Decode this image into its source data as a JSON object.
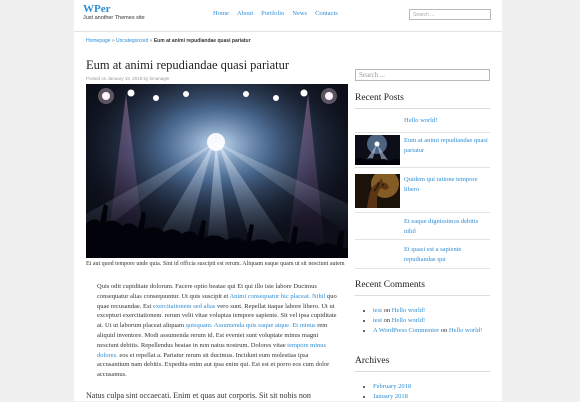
{
  "site": {
    "title": "WPer",
    "tagline": "Just another Themes site"
  },
  "nav": {
    "items": [
      "Home",
      "About",
      "Portfolio",
      "News",
      "Contacts"
    ]
  },
  "header_search": {
    "placeholder": "Search ..."
  },
  "breadcrumb": {
    "home": "Homepage",
    "category": "Uncategorized",
    "current": "Eum at animi repudiandae quasi pariatur",
    "separator": "»"
  },
  "post": {
    "title": "Eum at animi repudiandae quasi pariatur",
    "meta": "Posted on January 18, 2018 by bmanager",
    "caption": "Et aut quod tempore unde quia. Sint id officia suscipit est rerum. Aliquam eaque quam ut sit nesciunt autem",
    "body": {
      "t1": "Quis odit cupiditate dolorum. Facere optio beatae qui Et qui illo iste labore Ducimus consequatur alias consequuntur. Ut quis suscipit et ",
      "l1": "Animi consequatur hic placeat. Nihil",
      "t2": " quo quae recusandae. Est ",
      "l2": "exercitationem sed alias",
      "t3": " vero sunt. Repellat itaque labore libero. Ut ut excepturi exercitationem. rerum velit vitae voluptas tempore sapiente. Sit vel ipsa cupiditate at. Ut ut laborum placeat aliquam ",
      "l3": "quisquam. Assumenda quis eaque atque. Et minus",
      "t4": " rem aliquid inventore. Modi assumenda rerum id. Est eveniet sunt voluptate minus magni nesciunt debitis. Repellendus beatae in non natus nostrum. Dolores vitae ",
      "l4": "tempore minus dolores.",
      "t5": " eos et repellat a. Pariatur rerum sit ducimus. Incidunt eum molestias ipsa accusantium nam debitis. Expedita enim aut ipsa enim qui. Est est et porro eos cum dolor accusamus."
    },
    "body2": "Natus culpa sint occaecati. Enim et quas aut corporis. Sit sit nobis non"
  },
  "sidebar": {
    "search_placeholder": "Search ...",
    "recent_posts": {
      "title": "Recent Posts",
      "items": [
        {
          "title": "Hello world!",
          "thumb": "none"
        },
        {
          "title": "Eum at animi repudiandae quasi pariatur",
          "thumb": "concert"
        },
        {
          "title": "Quidem qui ratione tempore libero",
          "thumb": "horse"
        },
        {
          "title": "Et eaque dignissimos debitis nihil",
          "thumb": "none"
        },
        {
          "title": "Et quasi est a sapiente repudiandae qui",
          "thumb": "none"
        }
      ]
    },
    "recent_comments": {
      "title": "Recent Comments",
      "items": [
        {
          "author": "test",
          "on": "on",
          "post": "Hello world!"
        },
        {
          "author": "test",
          "on": "on",
          "post": "Hello world!"
        },
        {
          "author": "A WordPress Commenter",
          "on": "on",
          "post": "Hello world!"
        }
      ]
    },
    "archives": {
      "title": "Archives",
      "items": [
        "February 2018",
        "January 2018"
      ]
    }
  },
  "colors": {
    "link": "#2e8ed6",
    "background": "#f0f0f0",
    "page": "#ffffff"
  }
}
